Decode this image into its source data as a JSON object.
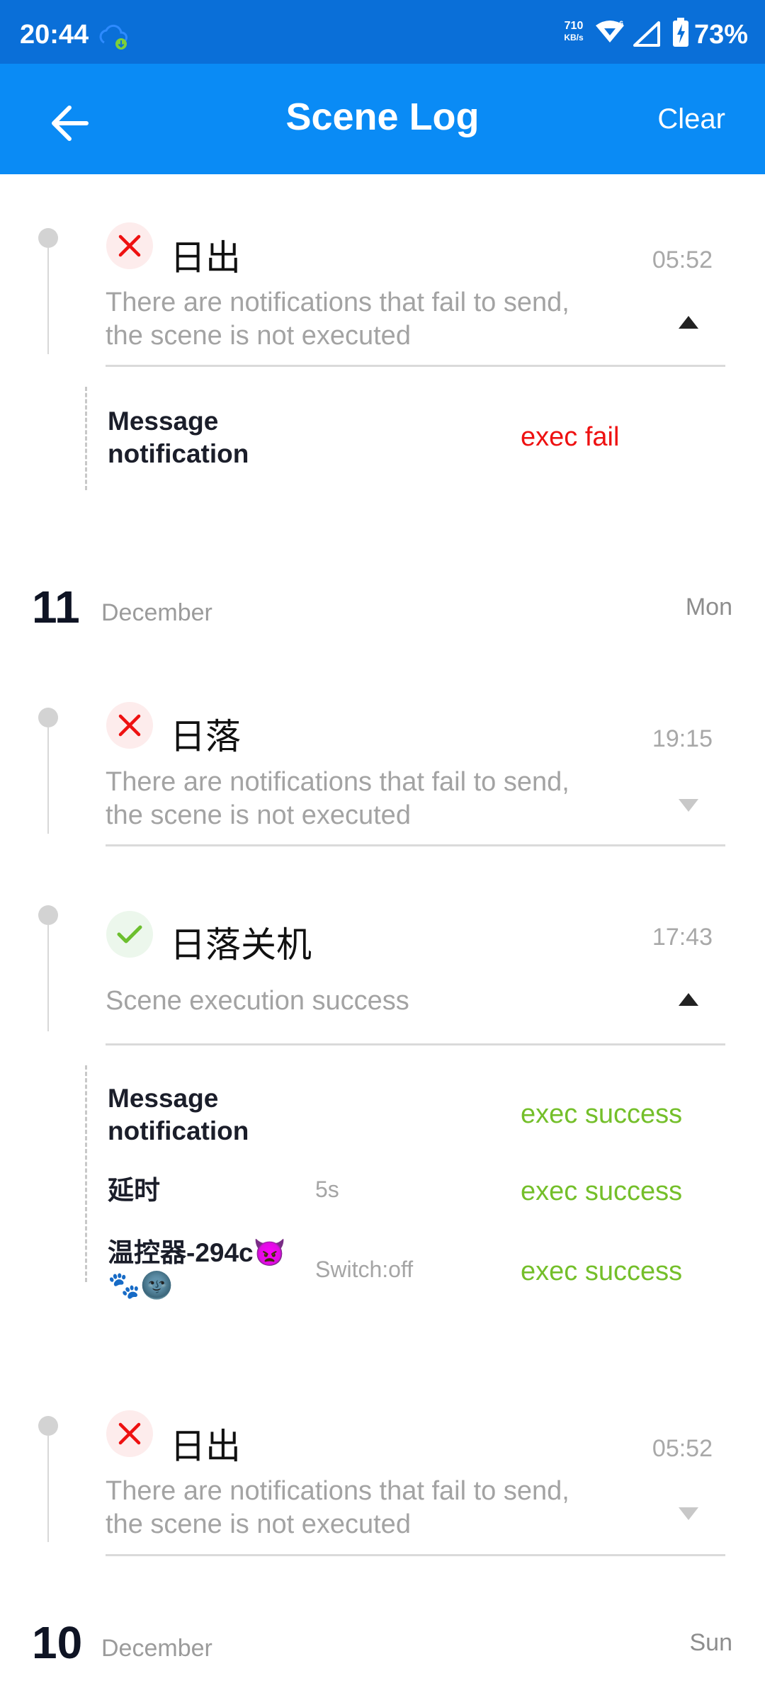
{
  "status_bar": {
    "time": "20:44",
    "net_speed_value": "710",
    "net_speed_unit": "KB/s",
    "wifi_badge": "6",
    "battery_percent": "73%",
    "icons": [
      "cloud-download-icon",
      "wifi-icon",
      "signal-icon",
      "battery-charging-icon"
    ]
  },
  "app_bar": {
    "title": "Scene Log",
    "back_icon": "arrow-left-icon",
    "clear_label": "Clear"
  },
  "colors": {
    "status_bar_bg": "#0a6fd8",
    "app_bar_bg": "#0a8bf5",
    "fail_red": "#ee1111",
    "success_green": "#74bf2a",
    "muted_gray": "#a3a3a3"
  },
  "entries": [
    {
      "status": "fail",
      "title": "日出",
      "time": "05:52",
      "desc_line1": "There are notifications that fail to send,",
      "desc_line2": "the scene is not executed",
      "expanded": true,
      "actions": [
        {
          "name_line1": "Message",
          "name_line2": "notification",
          "param": "",
          "result": "exec fail"
        }
      ]
    },
    {
      "status": "fail",
      "title": "日落",
      "time": "19:15",
      "desc_line1": "There are notifications that fail to send,",
      "desc_line2": "the scene is not executed",
      "expanded": false
    },
    {
      "status": "success",
      "title": "日落关机",
      "time": "17:43",
      "desc_line1": "Scene execution success",
      "expanded": true,
      "actions": [
        {
          "name_line1": "Message",
          "name_line2": "notification",
          "param": "",
          "result": "exec success"
        },
        {
          "name_line1": "延时",
          "param": "5s",
          "result": "exec success"
        },
        {
          "name_line1": "温控器-294c👿",
          "name_line2": "🐾🌚",
          "param": "Switch:off",
          "result": "exec success"
        }
      ]
    },
    {
      "status": "fail",
      "title": "日出",
      "time": "05:52",
      "desc_line1": "There are notifications that fail to send,",
      "desc_line2": "the scene is not executed",
      "expanded": false
    }
  ],
  "date_headers": [
    {
      "day": "11",
      "month": "December",
      "weekday": "Mon"
    },
    {
      "day": "10",
      "month": "December",
      "weekday": "Sun"
    }
  ]
}
